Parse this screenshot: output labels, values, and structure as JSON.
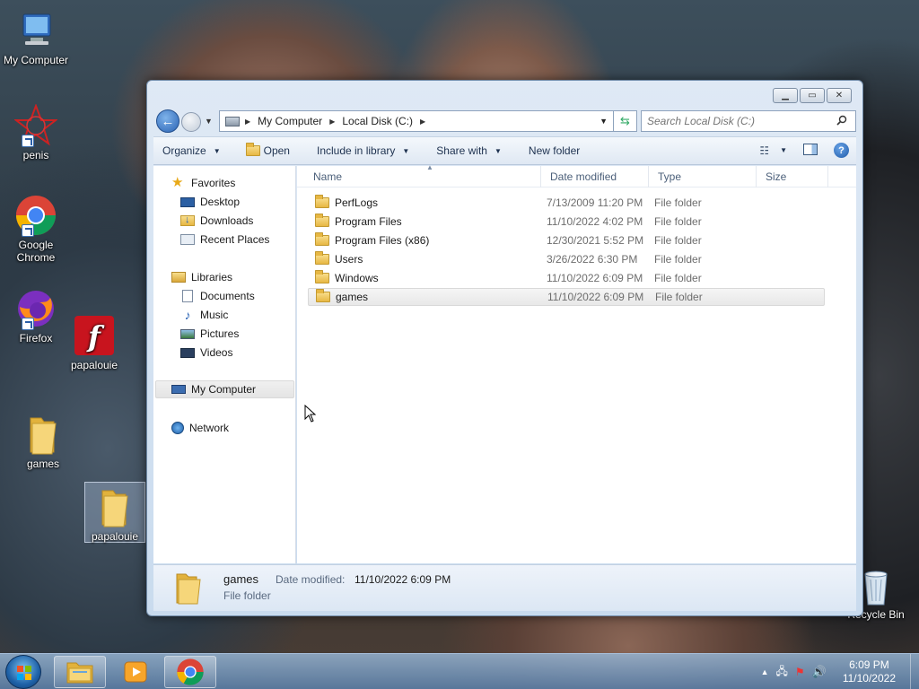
{
  "desktop": {
    "icons": [
      {
        "label": "My Computer"
      },
      {
        "label": "penis"
      },
      {
        "label": "Google Chrome"
      },
      {
        "label": "Firefox"
      },
      {
        "label": "papalouie"
      },
      {
        "label": "games"
      },
      {
        "label": "papalouie"
      },
      {
        "label": "Recycle Bin"
      }
    ]
  },
  "window": {
    "address": {
      "crumbs": [
        "My Computer",
        "Local Disk (C:)"
      ]
    },
    "search_placeholder": "Search Local Disk (C:)",
    "toolbar": {
      "organize": "Organize",
      "open": "Open",
      "include_in_library": "Include in library",
      "share_with": "Share with",
      "new_folder": "New folder"
    },
    "nav": {
      "favorites": "Favorites",
      "desktop": "Desktop",
      "downloads": "Downloads",
      "recent_places": "Recent Places",
      "libraries": "Libraries",
      "documents": "Documents",
      "music": "Music",
      "pictures": "Pictures",
      "videos": "Videos",
      "my_computer": "My Computer",
      "network": "Network"
    },
    "columns": {
      "name": "Name",
      "date_modified": "Date modified",
      "type": "Type",
      "size": "Size"
    },
    "files": [
      {
        "name": "PerfLogs",
        "date": "7/13/2009 11:20 PM",
        "type": "File folder"
      },
      {
        "name": "Program Files",
        "date": "11/10/2022 4:02 PM",
        "type": "File folder"
      },
      {
        "name": "Program Files (x86)",
        "date": "12/30/2021 5:52 PM",
        "type": "File folder"
      },
      {
        "name": "Users",
        "date": "3/26/2022 6:30 PM",
        "type": "File folder"
      },
      {
        "name": "Windows",
        "date": "11/10/2022 6:09 PM",
        "type": "File folder"
      },
      {
        "name": "games",
        "date": "11/10/2022 6:09 PM",
        "type": "File folder"
      }
    ],
    "details": {
      "name": "games",
      "date_label": "Date modified:",
      "date_value": "11/10/2022 6:09 PM",
      "type": "File folder"
    }
  },
  "taskbar": {
    "time": "6:09 PM",
    "date": "11/10/2022"
  }
}
